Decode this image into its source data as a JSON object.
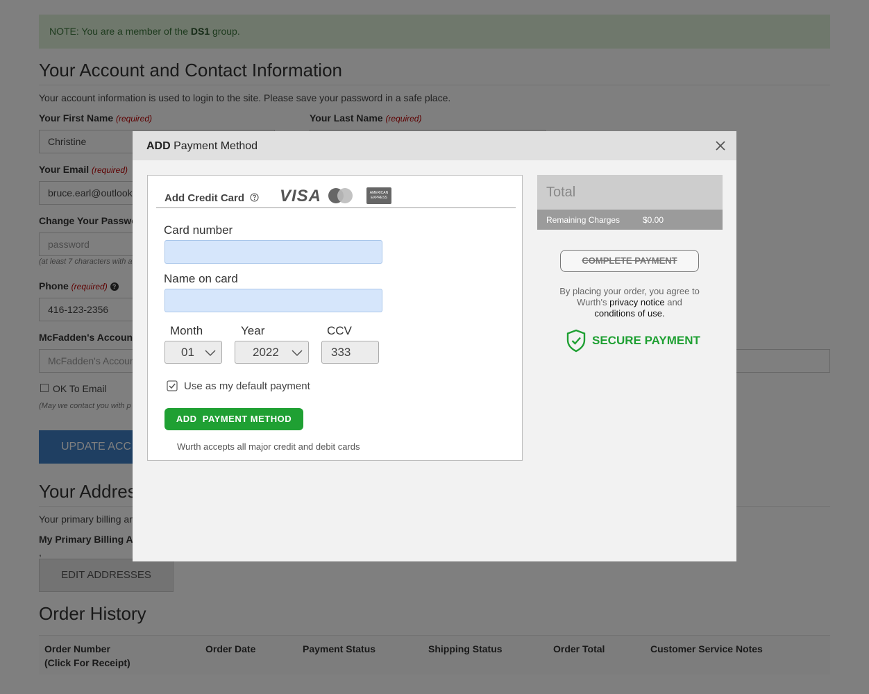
{
  "note": {
    "prefix": "NOTE: You are a member of the",
    "group": "DS1",
    "suffix": "group."
  },
  "account": {
    "title": "Your Account and Contact Information",
    "intro": "Your account information is used to login to the site. Please save your password in a safe place.",
    "first_name_label": "Your First Name",
    "last_name_label": "Your Last Name",
    "required": "(required)",
    "first_name_value": "Christine",
    "email_label": "Your Email",
    "email_value": "bruce.earl@outlook.",
    "password_label": "Change Your Passwor",
    "password_placeholder": "password",
    "password_hint": "(at least 7 characters with a",
    "phone_label": "Phone",
    "phone_value": "416-123-2356",
    "mcfadden_label": "McFadden's Account",
    "mcfadden_placeholder": "McFadden's Accoun",
    "ok_email_label": "OK To Email",
    "ok_email_hint": "(May we contact you with p",
    "update_button": "UPDATE ACC"
  },
  "addresses": {
    "title": "Your Addres",
    "intro": "Your primary billing ar",
    "billing_label": "My Primary Billing Ad",
    "dot": ",",
    "edit_button": "EDIT ADDRESSES"
  },
  "orders": {
    "title": "Order History",
    "columns": [
      "Order Number",
      "Order Date",
      "Payment Status",
      "Shipping Status",
      "Order Total",
      "Customer Service Notes"
    ],
    "column0_sub": "(Click For Receipt)"
  },
  "modal": {
    "title_bold": "ADD",
    "title_rest": "Payment Method",
    "tab_label": "Add Credit Card",
    "brands": {
      "visa": "VISA",
      "amex_line1": "AMERICAN",
      "amex_line2": "EXPRESS"
    },
    "card_number_label": "Card number",
    "name_on_card_label": "Name on card",
    "month_label": "Month",
    "year_label": "Year",
    "ccv_label": "CCV",
    "month_value": "01",
    "year_value": "2022",
    "ccv_value": "333",
    "default_label": "Use as my default payment",
    "default_checked": true,
    "add_button": "ADD  PAYMENT METHOD",
    "accepts_text": "Wurth accepts all major credit and debit cards",
    "total_label": "Total",
    "remaining_label": "Remaining Charges",
    "remaining_value": "$0.00",
    "complete_button": "COMPLETE PAYMENT",
    "agree_1": "By placing your order, you agree to",
    "agree_2": "Wurth's",
    "privacy_link": "privacy notice",
    "agree_3": "and",
    "conditions_link": "conditions of use.",
    "secure_label": "SECURE PAYMENT"
  },
  "colors": {
    "green": "#1fa033",
    "input_blue": "#d6e6fb",
    "note_bg": "#dff0d8"
  }
}
